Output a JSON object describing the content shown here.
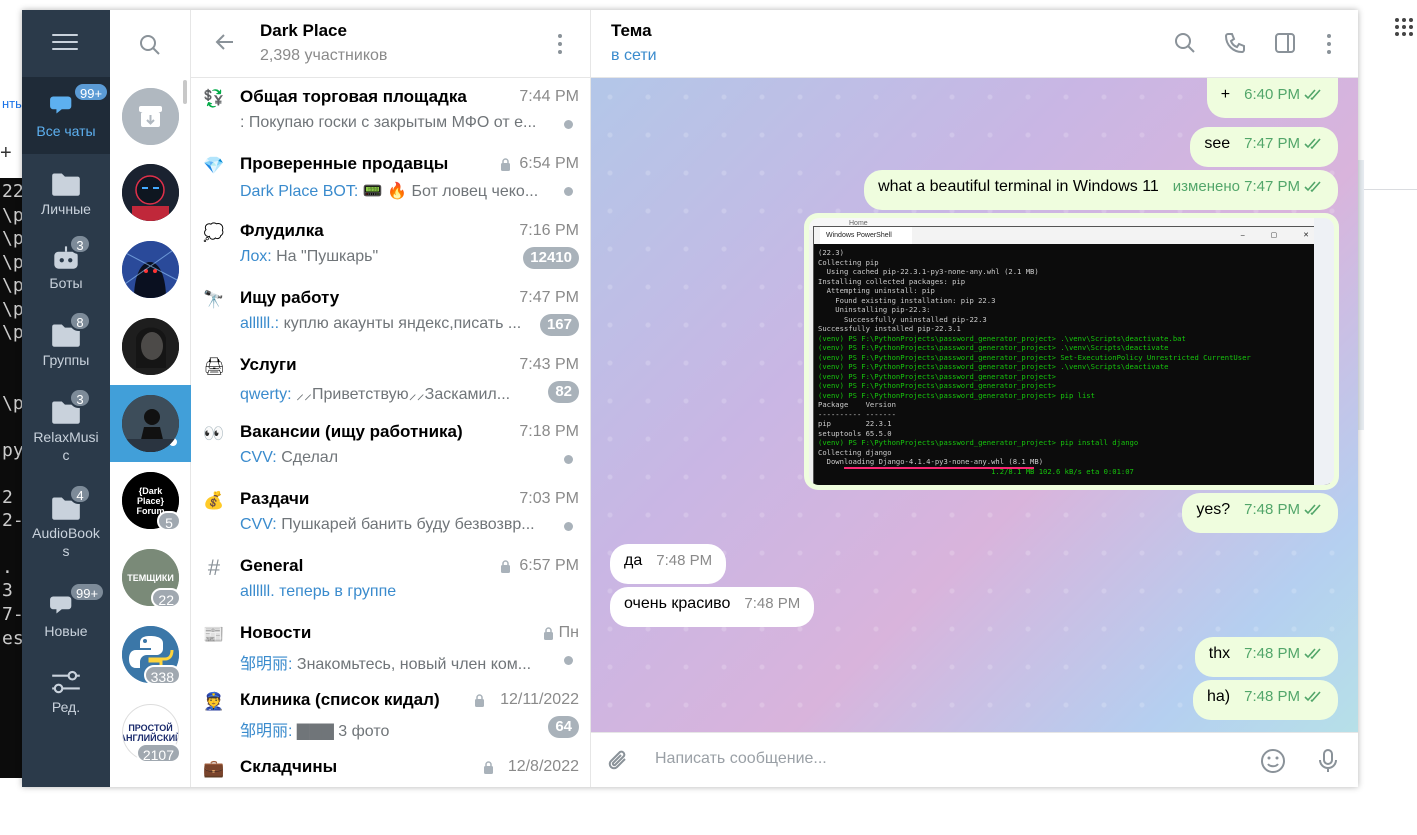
{
  "background": {
    "tab_fragment": "нты",
    "plus": "+",
    "terminal_lines": [
      "22",
      "\\p",
      "\\p",
      "\\p",
      "\\p",
      "\\p",
      "\\p",
      "",
      "",
      "\\p",
      "",
      "ру",
      "",
      "2",
      "2-",
      "",
      ". 3",
      "",
      "7-",
      "es"
    ]
  },
  "folders": [
    {
      "label": "Все чаты",
      "badge": "99+",
      "icon": "chat-bubbles-icon"
    },
    {
      "label": "Личные",
      "badge": "",
      "icon": "folder-icon"
    },
    {
      "label": "Боты",
      "badge": "3",
      "icon": "bot-icon"
    },
    {
      "label": "Группы",
      "badge": "8",
      "icon": "folder-icon"
    },
    {
      "label": "RelaxMusi c",
      "badge": "3",
      "icon": "folder-icon"
    },
    {
      "label": "AudioBook s",
      "badge": "4",
      "icon": "folder-icon"
    },
    {
      "label": "Новые",
      "badge": "99+",
      "icon": "chat-bubbles-icon"
    },
    {
      "label": "Ред.",
      "badge": "",
      "icon": "sliders-icon"
    }
  ],
  "avatars": [
    {
      "name": "archive",
      "badge": "",
      "color": "#b0b8c0"
    },
    {
      "name": "mask",
      "badge": "",
      "color": "#1a2230"
    },
    {
      "name": "hooded",
      "badge": "",
      "color": "#2a4a9a"
    },
    {
      "name": "girl",
      "badge": "",
      "color": "#3a3a3a"
    },
    {
      "name": "dark-place",
      "badge": "",
      "color": "#2e3e50"
    },
    {
      "name": "dark-place-forum",
      "badge": "5",
      "text": "{Dark Place} Forum",
      "color": "#000000"
    },
    {
      "name": "temshiki",
      "badge": "22",
      "text": "ТЕМЩИКИ",
      "color": "#7a8a78"
    },
    {
      "name": "python",
      "badge": "338",
      "color": "#3b77a8"
    },
    {
      "name": "prostoy-angliyskiy",
      "badge": "2107",
      "text": "ПРОСТОЙ АНГЛИЙСКИЙ",
      "color": "#ffffff"
    }
  ],
  "chatlist": {
    "title": "Dark Place",
    "subtitle": "2,398 участников",
    "rows": [
      {
        "icon": "💱",
        "title": "Общая торговая площадка",
        "time": "7:44 PM",
        "sender": "",
        "preview": ": Покупаю госки с закрытым МФО от е...",
        "badge": "",
        "dot": true,
        "lock": false
      },
      {
        "icon": "💎",
        "title": "Проверенные продавцы",
        "time": "6:54 PM",
        "sender": "Dark Place BOT:",
        "preview": " 📟 🔥 Бот ловец чеко...",
        "badge": "",
        "dot": true,
        "lock": true
      },
      {
        "icon": "💭",
        "title": "Флудилка",
        "time": "7:16 PM",
        "sender": "Лох:",
        "preview": " На \"Пушкарь\"",
        "badge": "12410",
        "dot": false,
        "lock": false
      },
      {
        "icon": "🔭",
        "title": "Ищу работу",
        "time": "7:47 PM",
        "sender": "allllll.:",
        "preview": " куплю акаунты яндекс,писать ...",
        "badge": "167",
        "dot": false,
        "lock": false
      },
      {
        "icon": "🖨",
        "title": "Услуги",
        "time": "7:43 PM",
        "sender": "qwerty:",
        "preview": " ⸝⸝Приветствую⸝⸝Заскамил...",
        "badge": "82",
        "dot": false,
        "lock": false
      },
      {
        "icon": "👀",
        "title": "Вакансии (ищу работника)",
        "time": "7:18 PM",
        "sender": "CVV:",
        "preview": " Сделал",
        "badge": "",
        "dot": true,
        "lock": false
      },
      {
        "icon": "💰",
        "title": "Раздачи",
        "time": "7:03 PM",
        "sender": "CVV:",
        "preview": " Пушкарей банить буду безвозвр...",
        "badge": "",
        "dot": true,
        "lock": false
      },
      {
        "icon": "#",
        "title": "General",
        "time": "6:57 PM",
        "sender": "allllll. теперь в группе",
        "preview": "",
        "badge": "",
        "dot": false,
        "lock": true
      },
      {
        "icon": "📰",
        "title": "Новости",
        "time": "Пн",
        "sender": "邹明丽:",
        "preview": " Знакомьтесь, новый член ком...",
        "badge": "",
        "dot": true,
        "lock": true
      },
      {
        "icon": "👮",
        "title": "Клиника (список кидал)",
        "time": "12/11/2022",
        "sender": "邹明丽:",
        "preview": " ▇▇▇ 3 фото",
        "badge": "64",
        "dot": false,
        "lock": true
      },
      {
        "icon": "💼",
        "title": "Складчины",
        "time": "12/8/2022",
        "sender": "",
        "preview": "",
        "badge": "",
        "dot": false,
        "lock": true
      }
    ]
  },
  "chat": {
    "title": "Тема",
    "status": "в сети",
    "composer_placeholder": "Написать сообщение...",
    "messages": [
      {
        "dir": "out",
        "text": "+",
        "meta": "6:40 PM"
      },
      {
        "dir": "out",
        "text": "see",
        "meta": "7:47 PM"
      },
      {
        "dir": "out",
        "text": "what a beautiful terminal in Windows 11",
        "meta": "изменено 7:47 PM"
      },
      {
        "dir": "out",
        "text": "yes?",
        "meta": "7:48 PM"
      },
      {
        "dir": "in",
        "text": "да",
        "meta": "7:48 PM"
      },
      {
        "dir": "in",
        "text": "очень красиво",
        "meta": "7:48 PM"
      },
      {
        "dir": "out",
        "text": "thx",
        "meta": "7:48 PM"
      },
      {
        "dir": "out",
        "text": "ha)",
        "meta": "7:48 PM"
      }
    ],
    "image": {
      "browser_text": "Home",
      "window_title": "Windows PowerShell",
      "lines": [
        {
          "t": "(22.3)",
          "c": ""
        },
        {
          "t": "Collecting pip",
          "c": ""
        },
        {
          "t": "  Using cached pip-22.3.1-py3-none-any.whl (2.1 MB)",
          "c": ""
        },
        {
          "t": "Installing collected packages: pip",
          "c": ""
        },
        {
          "t": "  Attempting uninstall: pip",
          "c": ""
        },
        {
          "t": "    Found existing installation: pip 22.3",
          "c": ""
        },
        {
          "t": "    Uninstalling pip-22.3:",
          "c": ""
        },
        {
          "t": "      Successfully uninstalled pip-22.3",
          "c": ""
        },
        {
          "t": "Successfully installed pip-22.3.1",
          "c": ""
        },
        {
          "t": "(venv) PS F:\\PythonProjects\\password_generator_project> .\\venv\\Scripts\\deactivate.bat",
          "c": "g"
        },
        {
          "t": "(venv) PS F:\\PythonProjects\\password_generator_project> .\\venv\\Scripts\\deactivate",
          "c": "g"
        },
        {
          "t": "(venv) PS F:\\PythonProjects\\password_generator_project> Set-ExecutionPolicy Unrestricted CurrentUser",
          "c": "g"
        },
        {
          "t": "(venv) PS F:\\PythonProjects\\password_generator_project> .\\venv\\Scripts\\deactivate",
          "c": "g"
        },
        {
          "t": "(venv) PS F:\\PythonProjects\\password_generator_project>",
          "c": "g"
        },
        {
          "t": "(venv) PS F:\\PythonProjects\\password_generator_project>",
          "c": "g"
        },
        {
          "t": "(venv) PS F:\\PythonProjects\\password_generator_project> pip list",
          "c": "g"
        },
        {
          "t": "Package    Version",
          "c": ""
        },
        {
          "t": "---------- -------",
          "c": ""
        },
        {
          "t": "pip        22.3.1",
          "c": ""
        },
        {
          "t": "setuptools 65.5.0",
          "c": ""
        },
        {
          "t": "(venv) PS F:\\PythonProjects\\password_generator_project> pip install django",
          "c": "g"
        },
        {
          "t": "Collecting django",
          "c": ""
        },
        {
          "t": "  Downloading Django-4.1.4-py3-none-any.whl (8.1 MB)",
          "c": ""
        },
        {
          "t": "                                        1.2/8.1 MB 102.6 kB/s eta 0:01:07",
          "c": "g"
        }
      ]
    }
  },
  "colors": {
    "accent": "#3a8bcd",
    "sidebar": "#2b3a4a",
    "outgoing": "#effdde"
  }
}
